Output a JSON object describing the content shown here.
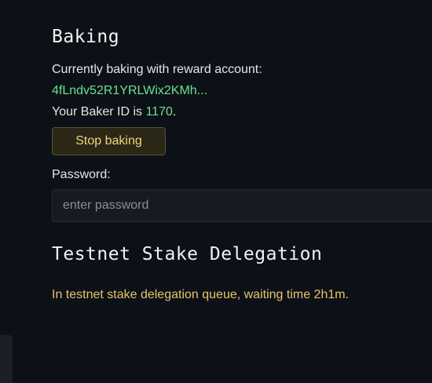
{
  "baking": {
    "title": "Baking",
    "currently_baking_label": "Currently baking with reward account:",
    "reward_account": "4fLndv52R1YRLWix2KMh...",
    "baker_id_prefix": "Your Baker ID is ",
    "baker_id": "1170",
    "baker_id_suffix": ".",
    "stop_button_label": "Stop baking",
    "password_label": "Password:",
    "password_placeholder": "enter password",
    "password_value": ""
  },
  "delegation": {
    "title": "Testnet Stake Delegation",
    "status_text": "In testnet stake delegation queue, waiting time 2h1m."
  },
  "colors": {
    "background": "#0c1117",
    "accent_green": "#6ee08f",
    "accent_yellow": "#e9c46a"
  }
}
